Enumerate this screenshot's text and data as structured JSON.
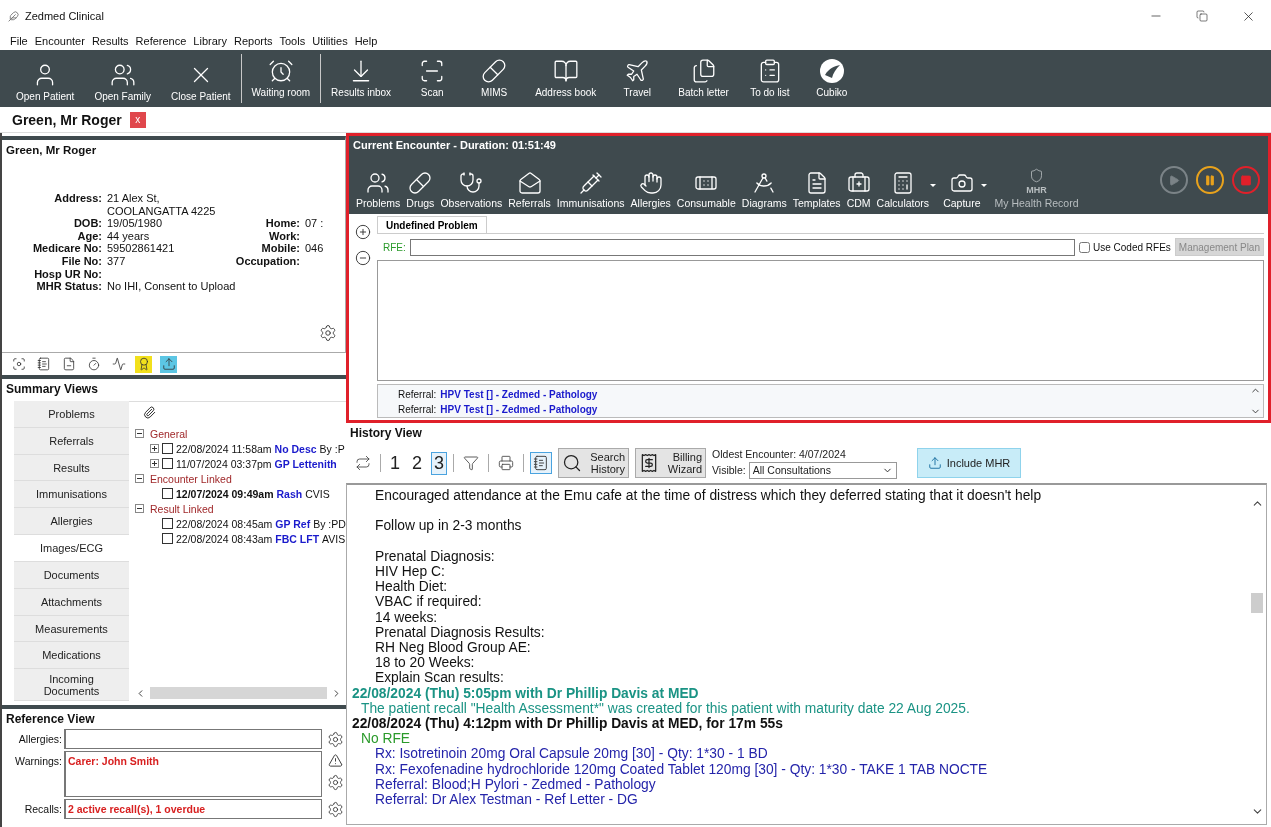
{
  "window": {
    "title": "Zedmed Clinical"
  },
  "menu": [
    "File",
    "Encounter",
    "Results",
    "Reference",
    "Library",
    "Reports",
    "Tools",
    "Utilities",
    "Help"
  ],
  "toolbar": [
    {
      "items": [
        {
          "kind": "user",
          "label": "Open Patient"
        },
        {
          "kind": "users",
          "label": "Open Family"
        },
        {
          "kind": "close",
          "label": "Close Patient"
        }
      ]
    },
    {
      "items": [
        {
          "kind": "alarm",
          "label": "Waiting room"
        }
      ]
    },
    {
      "items": [
        {
          "kind": "inbox",
          "label": "Results inbox"
        },
        {
          "kind": "scan",
          "label": "Scan"
        },
        {
          "kind": "pill",
          "label": "MIMS"
        },
        {
          "kind": "book",
          "label": "Address book"
        },
        {
          "kind": "plane",
          "label": "Travel"
        },
        {
          "kind": "files",
          "label": "Batch letter"
        },
        {
          "kind": "clipboard",
          "label": "To do list"
        },
        {
          "kind": "logo",
          "label": "Cubiko"
        }
      ]
    }
  ],
  "patient_tab": {
    "label": "Green, Mr Roger",
    "close": "x"
  },
  "patient": {
    "name": "Green, Mr Roger",
    "rows": [
      {
        "label": "Address:",
        "value": "21 Alex St,"
      },
      {
        "value": "COOLANGATTA  4225"
      },
      {
        "label": "DOB:",
        "value": "19/05/1980",
        "right_label": "Home:",
        "right_value": "07 :"
      },
      {
        "label": "Age:",
        "value": "44 years",
        "right_label": "Work:"
      },
      {
        "label": "Medicare No:",
        "value": "59502861421",
        "right_label": "Mobile:",
        "right_value": "046"
      },
      {
        "label": "File No:",
        "value": "377",
        "right_label": "Occupation:"
      },
      {
        "label": "Hosp UR No:"
      },
      {
        "label": "MHR Status:",
        "value": "No IHI, Consent to Upload"
      }
    ]
  },
  "patient_icons": [
    {
      "kind": "frame"
    },
    {
      "kind": "notepad"
    },
    {
      "kind": "document"
    },
    {
      "kind": "stopwatch"
    },
    {
      "kind": "ecg"
    },
    {
      "kind": "badge",
      "color": "#f2e01c"
    },
    {
      "kind": "upload",
      "color": "#5cc6e4"
    }
  ],
  "summary": {
    "title": "Summary Views",
    "tabs": [
      {
        "label": "Problems",
        "selected": false
      },
      {
        "label": "Referrals",
        "selected": false
      },
      {
        "label": "Results",
        "selected": false
      },
      {
        "label": "Immunisations",
        "selected": false
      },
      {
        "label": "Allergies",
        "selected": false
      },
      {
        "label": "Images/ECG",
        "selected": true
      },
      {
        "label": "Documents",
        "selected": false
      },
      {
        "label": "Attachments",
        "selected": false
      },
      {
        "label": "Measurements",
        "selected": false
      },
      {
        "label": "Medications",
        "selected": false
      },
      {
        "label": "Incoming Documents",
        "selected": false
      }
    ],
    "tree": [
      {
        "label": "General",
        "expanded": true,
        "children": [
          {
            "expandable": true,
            "checked": false,
            "emphasized": false,
            "date": "22/08/2024 11:58am",
            "title": "No Desc",
            "extra": "By :P"
          },
          {
            "expandable": true,
            "checked": false,
            "emphasized": false,
            "date": "11/07/2024 03:37pm",
            "title": "GP Lettenith"
          }
        ]
      },
      {
        "label": "Encounter Linked",
        "expanded": true,
        "children": [
          {
            "expandable": false,
            "checked": false,
            "emphasized": true,
            "date": "12/07/2024 09:49am",
            "title": "Rash",
            "extra": "CVIS"
          }
        ]
      },
      {
        "label": "Result Linked",
        "expanded": true,
        "children": [
          {
            "expandable": false,
            "checked": false,
            "emphasized": false,
            "date": "22/08/2024 08:45am",
            "title": "GP Ref",
            "extra": "By :PD"
          },
          {
            "expandable": false,
            "checked": false,
            "emphasized": false,
            "date": "22/08/2024 08:43am",
            "title": "FBC LFT",
            "extra": "AVIS"
          }
        ]
      }
    ]
  },
  "reference": {
    "title": "Reference View",
    "fields": [
      {
        "kind": "single",
        "label": "Allergies:"
      },
      {
        "kind": "multi",
        "label": "Warnings:",
        "value": "Carer: John Smith"
      },
      {
        "kind": "single",
        "label": "Recalls:",
        "value": "2 active recall(s), 1 overdue"
      }
    ]
  },
  "encounter": {
    "title": "Current Encounter - Duration: 01:51:49",
    "tools": [
      {
        "kind": "problems",
        "label": "Problems",
        "dropdown": false,
        "disabled": false
      },
      {
        "kind": "drugs",
        "label": "Drugs",
        "dropdown": false,
        "disabled": false
      },
      {
        "kind": "observations",
        "label": "Observations",
        "dropdown": false,
        "disabled": false
      },
      {
        "kind": "referrals",
        "label": "Referrals",
        "dropdown": false,
        "disabled": false
      },
      {
        "kind": "immunisations",
        "label": "Immunisations",
        "dropdown": false,
        "disabled": false
      },
      {
        "kind": "allergies",
        "label": "Allergies",
        "dropdown": false,
        "disabled": false
      },
      {
        "kind": "consumable",
        "label": "Consumable",
        "dropdown": false,
        "disabled": false
      },
      {
        "kind": "diagrams",
        "label": "Diagrams",
        "dropdown": false,
        "disabled": false
      },
      {
        "kind": "templates",
        "label": "Templates",
        "dropdown": false,
        "disabled": false
      },
      {
        "kind": "cdm",
        "label": "CDM",
        "dropdown": false,
        "disabled": false
      },
      {
        "kind": "calculators",
        "label": "Calculators",
        "dropdown": true,
        "disabled": false
      },
      {
        "kind": "capture",
        "label": "Capture",
        "dropdown": true,
        "disabled": false
      },
      {
        "kind": "mhr",
        "label": "My Health Record",
        "badge": "MHR",
        "dropdown": false,
        "disabled": true
      }
    ],
    "session_controls": [
      {
        "kind": "play",
        "disabled": true
      },
      {
        "kind": "pause",
        "disabled": false
      },
      {
        "kind": "stop",
        "disabled": false
      }
    ],
    "problem_tabs": [
      {
        "label": "Undefined Problem",
        "selected": true
      }
    ],
    "rfe": {
      "label": "RFE:",
      "coded": {
        "label": "Use Coded RFEs",
        "checked": false
      },
      "plan_button": {
        "label": "Management Plan",
        "disabled": true
      }
    },
    "referrals": [
      {
        "label": "Referral:",
        "value": "HPV Test [] - Zedmed - Pathology"
      },
      {
        "label": "Referral:",
        "value": "HPV Test [] - Zedmed - Pathology"
      }
    ]
  },
  "history": {
    "title": "History View",
    "pages": [
      {
        "label": "1",
        "selected": false
      },
      {
        "label": "2",
        "selected": false
      },
      {
        "label": "3",
        "selected": true
      }
    ],
    "notes_view_selected": true,
    "search_button": "Search History",
    "billing_button": "Billing Wizard",
    "oldest": "Oldest Encounter: 4/07/2024",
    "visible": {
      "label": "Visible:",
      "value": "All Consultations"
    },
    "include_mhr": {
      "label": "Include MHR",
      "on": true
    },
    "lines": [
      {
        "kind": "text",
        "gap_before": false,
        "text": "Encouraged attendance at the Emu cafe at the time of distress which they deferred stating that it doesn't help"
      },
      {
        "kind": "text",
        "gap_before": true,
        "text": "Follow up in 2-3 months"
      },
      {
        "kind": "text",
        "gap_before": true,
        "text": "Prenatal Diagnosis:"
      },
      {
        "kind": "text",
        "gap_before": false,
        "text": "HIV Hep C:"
      },
      {
        "kind": "text",
        "gap_before": false,
        "text": "Health Diet:"
      },
      {
        "kind": "text",
        "gap_before": false,
        "text": "VBAC if required:"
      },
      {
        "kind": "text",
        "gap_before": false,
        "text": "14 weeks:"
      },
      {
        "kind": "text",
        "gap_before": false,
        "text": "Prenatal Diagnosis Results:"
      },
      {
        "kind": "text",
        "gap_before": false,
        "text": "RH Neg Blood Group AE:"
      },
      {
        "kind": "text",
        "gap_before": false,
        "text": "18 to 20 Weeks:"
      },
      {
        "kind": "text",
        "gap_before": false,
        "text": "Explain Scan results:"
      },
      {
        "kind": "event",
        "gap_before": false,
        "text": "22/08/2024 (Thu) 5:05pm with Dr Phillip Davis at MED"
      },
      {
        "kind": "eventnote",
        "gap_before": false,
        "text": "The patient recall \"Health Assessment*\" was created for this patient with maturity date 22 Aug 2025."
      },
      {
        "kind": "visit",
        "gap_before": false,
        "text": "22/08/2024 (Thu) 4:12pm with Dr Phillip Davis at MED, for 17m 55s"
      },
      {
        "kind": "rfe",
        "gap_before": false,
        "text": "No RFE"
      },
      {
        "kind": "entry",
        "gap_before": false,
        "text": "Rx: Isotretinoin 20mg Oral Capsule 20mg [30] - Qty: 1*30 - 1 BD"
      },
      {
        "kind": "entry",
        "gap_before": false,
        "text": "Rx: Fexofenadine hydrochloride 120mg Coated Tablet 120mg [30] - Qty: 1*30 - TAKE 1 TAB NOCTE"
      },
      {
        "kind": "entry",
        "gap_before": false,
        "text": "Referral: Blood;H Pylori - Zedmed - Pathology"
      },
      {
        "kind": "entry",
        "gap_before": false,
        "text": "Referral: Dr Alex Testman - Ref Letter - DG"
      }
    ]
  }
}
